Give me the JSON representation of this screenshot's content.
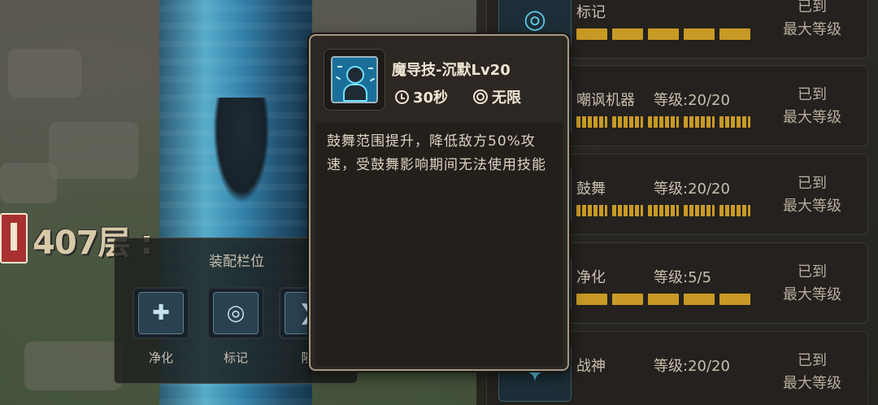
{
  "floor": {
    "label": "407层 :"
  },
  "equip": {
    "title": "装配栏位",
    "slots": [
      {
        "label": "净化",
        "icon": "purify-icon"
      },
      {
        "label": "标记",
        "icon": "crosshair-icon"
      },
      {
        "label": "陨",
        "icon": "meteor-icon"
      }
    ]
  },
  "skills": [
    {
      "name": "标记",
      "level": "",
      "status": [
        "已到",
        "最大等级"
      ],
      "icon": "crosshair-icon"
    },
    {
      "name": "嘲讽机器",
      "level": "等级:20/20",
      "status": [
        "已到",
        "最大等级"
      ],
      "icon": "taunt-machine-icon"
    },
    {
      "name": "鼓舞",
      "level": "等级:20/20",
      "status": [
        "已到",
        "最大等级"
      ],
      "icon": "inspire-icon"
    },
    {
      "name": "净化",
      "level": "等级:5/5",
      "status": [
        "已到",
        "最大等级"
      ],
      "icon": "purify-icon"
    },
    {
      "name": "战神",
      "level": "等级:20/20",
      "status": [
        "已到",
        "最大等级"
      ],
      "icon": "war-god-icon"
    }
  ],
  "tooltip": {
    "title": "魔导技-沉默Lv20",
    "cooldown": "30秒",
    "range": "无限",
    "description": "鼓舞范围提升，降低敌方50%攻速，受鼓舞影响期间无法使用技能",
    "icon": "silence-icon"
  },
  "colors": {
    "bar_gold": "#c89a25",
    "panel_bg": "#24211e",
    "tooltip_border": "#a69a86"
  }
}
